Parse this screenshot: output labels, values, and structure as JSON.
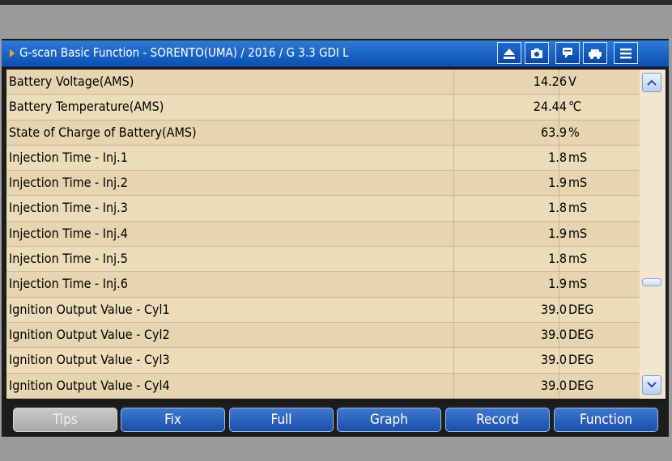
{
  "window": {
    "title": "G-scan Basic Function - SORENTO(UMA) / 2016 / G 3.3 GDI L"
  },
  "toolbar_icons": [
    "eject-icon",
    "camera-icon",
    "chat-icon",
    "car-icon",
    "menu-icon"
  ],
  "rows": [
    {
      "name": "Battery Voltage(AMS)",
      "value": "14.26",
      "unit": "V"
    },
    {
      "name": "Battery Temperature(AMS)",
      "value": "24.44",
      "unit": "℃"
    },
    {
      "name": "State of Charge of Battery(AMS)",
      "value": "63.9",
      "unit": "%"
    },
    {
      "name": "Injection Time - Inj.1",
      "value": "1.8",
      "unit": "mS"
    },
    {
      "name": "Injection Time - Inj.2",
      "value": "1.9",
      "unit": "mS"
    },
    {
      "name": "Injection Time - Inj.3",
      "value": "1.8",
      "unit": "mS"
    },
    {
      "name": "Injection Time - Inj.4",
      "value": "1.9",
      "unit": "mS"
    },
    {
      "name": "Injection Time - Inj.5",
      "value": "1.8",
      "unit": "mS"
    },
    {
      "name": "Injection Time - Inj.6",
      "value": "1.9",
      "unit": "mS"
    },
    {
      "name": "Ignition Output Value - Cyl1",
      "value": "39.0",
      "unit": "DEG"
    },
    {
      "name": "Ignition Output Value - Cyl2",
      "value": "39.0",
      "unit": "DEG"
    },
    {
      "name": "Ignition Output Value - Cyl3",
      "value": "39.0",
      "unit": "DEG"
    },
    {
      "name": "Ignition Output Value - Cyl4",
      "value": "39.0",
      "unit": "DEG"
    }
  ],
  "bottom_buttons": {
    "tips": "Tips",
    "fix": "Fix",
    "full": "Full",
    "graph": "Graph",
    "record": "Record",
    "function": "Function"
  },
  "colors": {
    "title_bar": "#0b4fb3",
    "row_background": "#e7d4b0",
    "button_blue": "#1a4fa6",
    "arrow_orange": "#f2a233"
  }
}
